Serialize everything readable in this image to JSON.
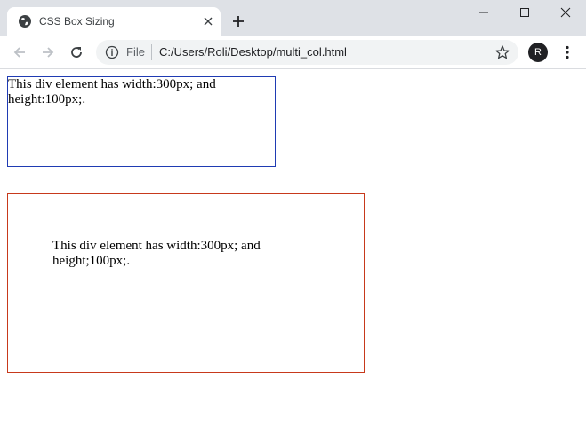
{
  "tab": {
    "title": "CSS Box Sizing"
  },
  "address_bar": {
    "scheme_label": "File",
    "url": "C:/Users/Roli/Desktop/multi_col.html"
  },
  "profile": {
    "initial": "R"
  },
  "page": {
    "box1_text": "This div element has width:300px; and height:100px;.",
    "box2_text": "This div element has width:300px; and height;100px;."
  },
  "colors": {
    "box1_border": "#1f3bb3",
    "box2_border": "#c7391b",
    "tabstrip_bg": "#dee1e6"
  },
  "icons": [
    "globe-icon",
    "close-icon",
    "plus-icon",
    "minimize-icon",
    "maximize-icon",
    "window-close-icon",
    "back-arrow-icon",
    "forward-arrow-icon",
    "reload-icon",
    "info-icon",
    "star-icon",
    "kebab-menu-icon"
  ]
}
